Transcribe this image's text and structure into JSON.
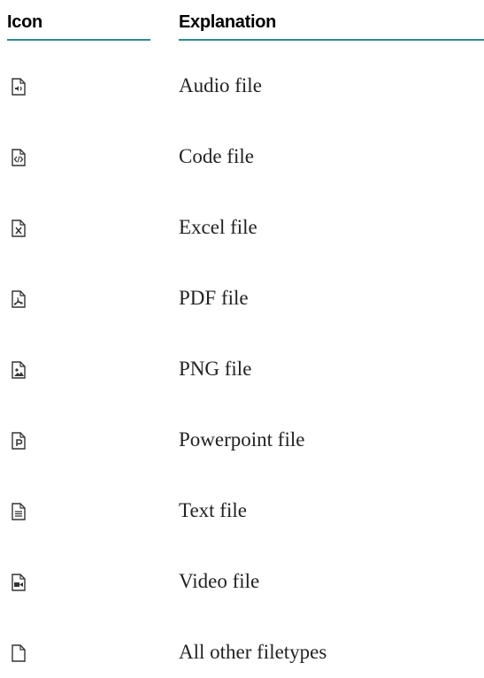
{
  "table": {
    "headers": {
      "icon": "Icon",
      "explanation": "Explanation"
    },
    "rows": [
      {
        "icon": "audio-file-icon",
        "label": "Audio file"
      },
      {
        "icon": "code-file-icon",
        "label": "Code file"
      },
      {
        "icon": "excel-file-icon",
        "label": "Excel file"
      },
      {
        "icon": "pdf-file-icon",
        "label": "PDF file"
      },
      {
        "icon": "png-file-icon",
        "label": "PNG file"
      },
      {
        "icon": "powerpoint-file-icon",
        "label": "Powerpoint file"
      },
      {
        "icon": "text-file-icon",
        "label": "Text file"
      },
      {
        "icon": "video-file-icon",
        "label": "Video file"
      },
      {
        "icon": "generic-file-icon",
        "label": "All other filetypes"
      }
    ]
  },
  "colors": {
    "rule": "#2f8a96",
    "icon_stroke": "#333333"
  }
}
